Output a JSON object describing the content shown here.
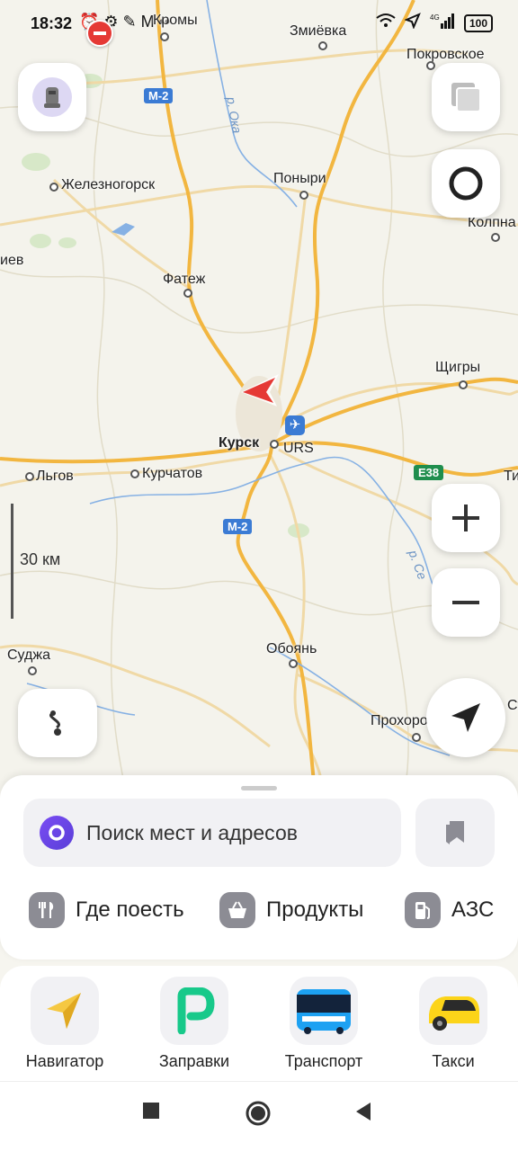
{
  "status": {
    "time": "18:32",
    "battery": "100",
    "network": "4G"
  },
  "map": {
    "cities": [
      {
        "name": "Змиёвка",
        "bold": false
      },
      {
        "name": "Покровское",
        "bold": false
      },
      {
        "name": "Кромы",
        "bold": false
      },
      {
        "name": "Железногорск",
        "bold": false
      },
      {
        "name": "Поныри",
        "bold": false
      },
      {
        "name": "Колпна",
        "bold": false
      },
      {
        "name": "Фатеж",
        "bold": false
      },
      {
        "name": "Щигры",
        "bold": false
      },
      {
        "name": "Курск",
        "bold": true
      },
      {
        "name": "URS",
        "bold": false
      },
      {
        "name": "Льгов",
        "bold": false
      },
      {
        "name": "Курчатов",
        "bold": false
      },
      {
        "name": "Суджа",
        "bold": false
      },
      {
        "name": "Обоянь",
        "bold": false
      },
      {
        "name": "Прохоровка",
        "bold": false
      },
      {
        "name": "иев",
        "bold": false
      },
      {
        "name": "Ти",
        "bold": false
      },
      {
        "name": "Ст",
        "bold": false
      }
    ],
    "road_labels": {
      "m2_top": "М-2",
      "m2_bottom": "М-2",
      "e38": "E38"
    },
    "river_labels": {
      "oka": "р. Ока",
      "seim": "р. Се"
    },
    "scale_label": "30 км"
  },
  "sheet": {
    "search_placeholder": "Поиск мест и адресов",
    "categories": [
      {
        "label": "Где поесть",
        "icon": "fork-knife-icon"
      },
      {
        "label": "Продукты",
        "icon": "basket-icon"
      },
      {
        "label": "АЗС",
        "icon": "fuel-icon"
      }
    ]
  },
  "apps": [
    {
      "label": "Навигатор",
      "icon": "navigator-icon"
    },
    {
      "label": "Заправки",
      "icon": "refuel-icon"
    },
    {
      "label": "Транспорт",
      "icon": "bus-icon"
    },
    {
      "label": "Такси",
      "icon": "taxi-icon"
    }
  ],
  "colors": {
    "road_major": "#f2b640",
    "road_minor": "#f0d9a6",
    "water": "#86b1e4",
    "map_bg": "#f4f3ec",
    "accent_alice": "#6d45ee",
    "nav_arrow": "#e53935"
  }
}
